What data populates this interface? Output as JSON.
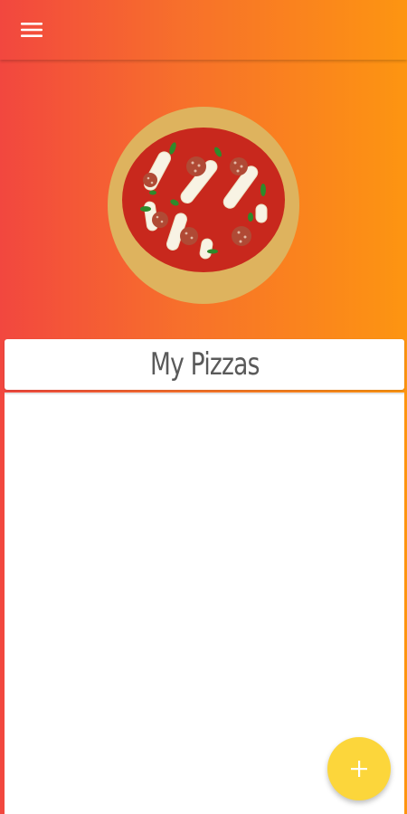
{
  "header": {
    "menu_icon": "menu-icon"
  },
  "hero": {
    "image": "pizza-illustration"
  },
  "title_card": {
    "title": "My Pizzas"
  },
  "list": {
    "items": []
  },
  "fab": {
    "icon": "plus-icon",
    "color": "#fcd63b"
  },
  "colors": {
    "gradient_start": "#f2473f",
    "gradient_end": "#fd9511",
    "card": "#ffffff",
    "title_text": "#5a5a5a"
  }
}
